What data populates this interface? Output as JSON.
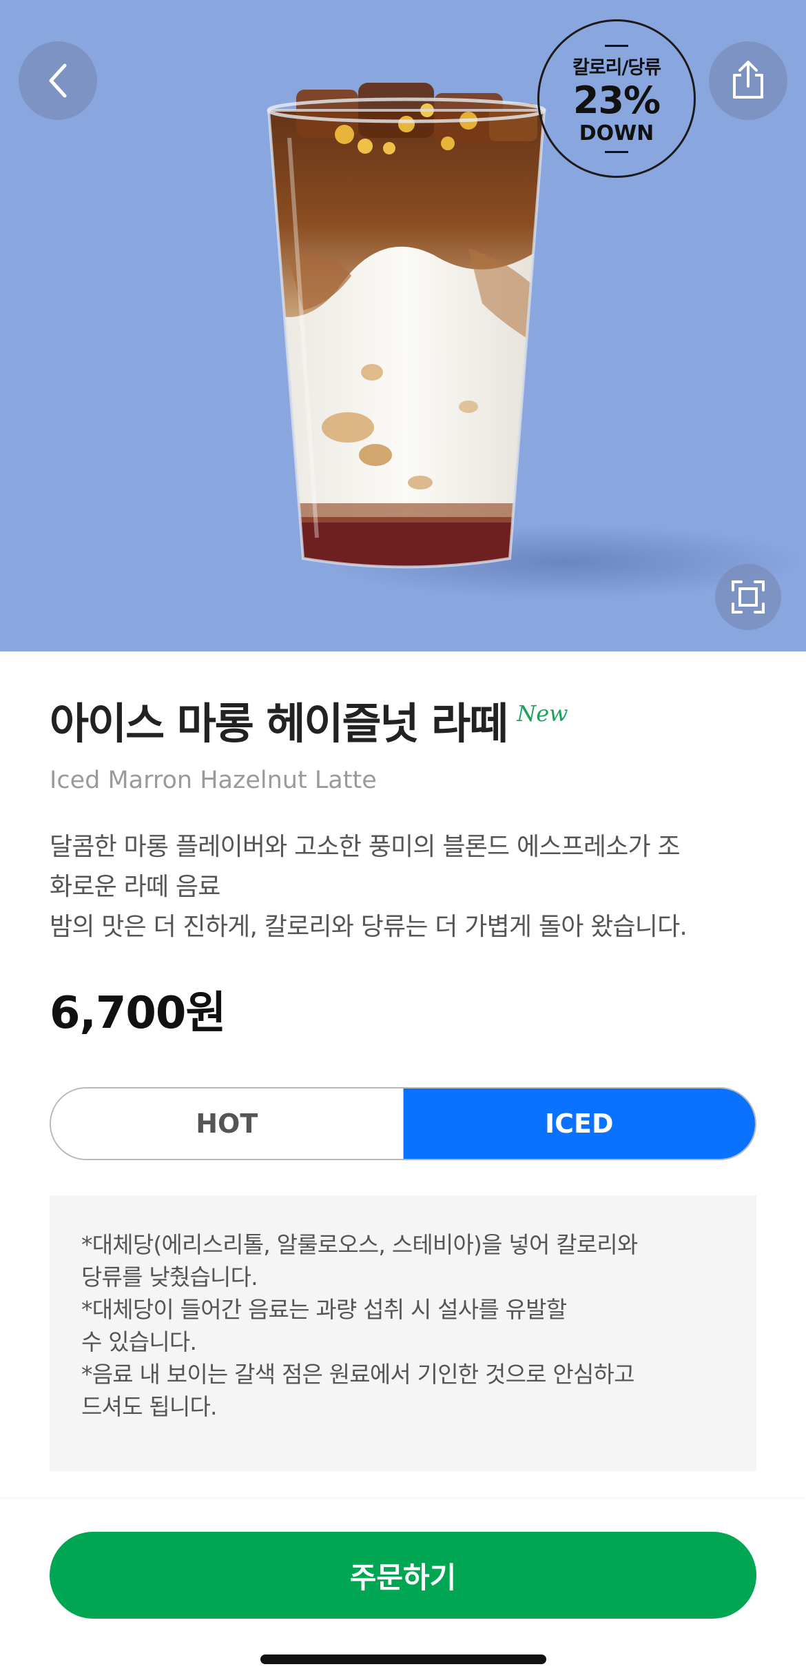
{
  "hero": {
    "badge": {
      "top_text": "칼로리/당류",
      "percent": "23%",
      "down_text": "DOWN"
    },
    "icons": {
      "back": "chevron-left-icon",
      "share": "share-icon",
      "zoom": "expand-icon"
    },
    "colors": {
      "background": "#8aa6df"
    }
  },
  "product": {
    "name_ko": "아이스 마롱 헤이즐넛 라떼",
    "new_tag": "New",
    "name_en": "Iced Marron Hazelnut Latte",
    "description_lines": [
      "달콤한 마롱 플레이버와 고소한 풍미의 블론드 에스프레소가 조",
      "화로운 라떼 음료",
      "밤의 맛은 더 진하게, 칼로리와 당류는 더 가볍게 돌아 왔습니다."
    ],
    "price": "6,700원"
  },
  "temperature": {
    "options": [
      "HOT",
      "ICED"
    ],
    "selected": "ICED"
  },
  "notice": {
    "lines": [
      "*대체당(에리스리톨, 알룰로오스, 스테비아)을 넣어 칼로리와",
      "당류를 낮췄습니다.",
      "*대체당이 들어간 음료는 과량 섭취 시 설사를 유발할",
      "수 있습니다.",
      "*음료 내 보이는 갈색 점은 원료에서 기인한 것으로 안심하고",
      "드셔도 됩니다."
    ]
  },
  "bottom": {
    "order_label": "주문하기",
    "colors": {
      "order_button": "#00a651",
      "selected_segment": "#0a72ff",
      "new_tag": "#1aa25a"
    }
  }
}
